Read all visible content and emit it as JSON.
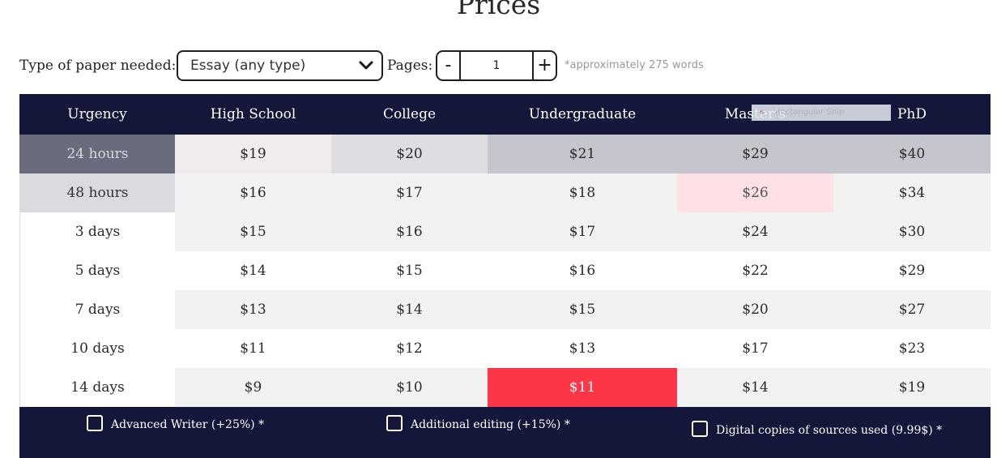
{
  "title": "Prices",
  "controls": {
    "paper_label": "Type of paper needed:",
    "paper_value": "Essay (any type)",
    "pages_label": "Pages:",
    "pages_minus": "-",
    "pages_value": "1",
    "pages_plus": "+",
    "words_note": "*approximately 275 words"
  },
  "table": {
    "headers": [
      "Urgency",
      "High School",
      "College",
      "Undergraduate",
      "Master’s",
      "PhD"
    ],
    "rows": [
      {
        "urgency": "24 hours",
        "prices": [
          "$19",
          "$20",
          "$21",
          "$29",
          "$40"
        ]
      },
      {
        "urgency": "48 hours",
        "prices": [
          "$16",
          "$17",
          "$18",
          "$26",
          "$34"
        ]
      },
      {
        "urgency": "3 days",
        "prices": [
          "$15",
          "$16",
          "$17",
          "$24",
          "$30"
        ]
      },
      {
        "urgency": "5 days",
        "prices": [
          "$14",
          "$15",
          "$16",
          "$22",
          "$29"
        ]
      },
      {
        "urgency": "7 days",
        "prices": [
          "$13",
          "$14",
          "$15",
          "$20",
          "$27"
        ]
      },
      {
        "urgency": "10 days",
        "prices": [
          "$11",
          "$12",
          "$13",
          "$17",
          "$23"
        ]
      },
      {
        "urgency": "14 days",
        "prices": [
          "$9",
          "$10",
          "$11",
          "$14",
          "$19"
        ]
      }
    ],
    "selected": {
      "urgency": "14 days",
      "level": "Undergraduate",
      "price": "$11"
    }
  },
  "overlay": {
    "snip_label": "Rectangular Snip"
  },
  "addons": [
    {
      "label": "Advanced Writer (+25%) *",
      "checked": false
    },
    {
      "label": "Additional editing (+15%) *",
      "checked": false
    },
    {
      "label": "Digital copies of sources used (9.99$) *",
      "checked": false
    }
  ],
  "colors": {
    "header_bg": "#15173a",
    "selected_price_bg": "#fc3547",
    "hover_price_bg": "#fde1e5",
    "highlight_row_bg": "#c5c5cd"
  }
}
